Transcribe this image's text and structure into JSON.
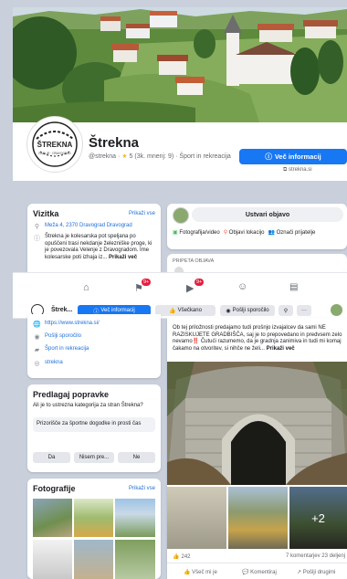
{
  "page": {
    "name": "Štrekna",
    "handle": "@strekna",
    "rating": "5 (3k. mnenj: 9)",
    "category": "Šport in rekreacija",
    "more_info_label": "Več informacij",
    "website_short": "strekna.si",
    "avatar_text": "ŠTREKNA",
    "avatar_subtext": "RADLJE · DRAVOGRAD"
  },
  "intro": {
    "title": "Vizitka",
    "edit": "Prikaži vse",
    "address": "Meža 4, 2370 Dravograd Dravograd",
    "description": "Štrekna je kolesarska pot speljana po opuščeni trasi nekdanje železniške proge, ki je povezovala Velenje z Dravogradom. Ime kolesarske poti izhaja iz...",
    "see_more": "Prikaži več"
  },
  "composer": {
    "create_post": "Ustvari objavo",
    "photo_video": "Fotografija/video",
    "checkin": "Objavi lokacijo",
    "tag": "Označi prijatelje",
    "pinned": "PRIPETA OBJAVA"
  },
  "tabbar": {
    "badge1": "9+",
    "badge2": "9+"
  },
  "sticky": {
    "name": "Štrek...",
    "more_info": "Več informacij",
    "like": "Všečkano",
    "send": "Pošlji sporočilo"
  },
  "details": {
    "website": "https://www.strekna.si/",
    "message": "Pošlji sporočilo",
    "category": "Šport in rekreacija",
    "handle": "strekna"
  },
  "suggest": {
    "title": "Predlagaj popravke",
    "question": "Ali je to ustrezna kategorija za stran Štrekna?",
    "category": "Prizorišče za športne dogodke in prosti čas",
    "yes": "Da",
    "unsure": "Nisem pre...",
    "no": "Ne"
  },
  "photos": {
    "title": "Fotografije",
    "see_all": "Prikaži vse"
  },
  "post": {
    "text": "Ob tej priložnosti predajamo tudi prošnjo izvajalcev da sami NE RAZISKUJETE GRADBIŠČA, saj je to prepovedano in predvsem zelo nevarno‼️ Čutući razumemo, da je gradnja zanimiva in tudi mi komaj čakamo na otvoritev, si nihče ne želi...",
    "see_more": "Prikaži več",
    "more_photos": "+2",
    "reactions": "242",
    "comments_shares": "7 komentarjev 23 deljenj",
    "like": "Všeč mi je",
    "comment": "Komentiraj",
    "share": "Pošlji drugimi"
  },
  "colors": {
    "accent": "#1877f2",
    "cover_sky": "#d4e2ec",
    "page_bg": "#c9d0dc"
  }
}
